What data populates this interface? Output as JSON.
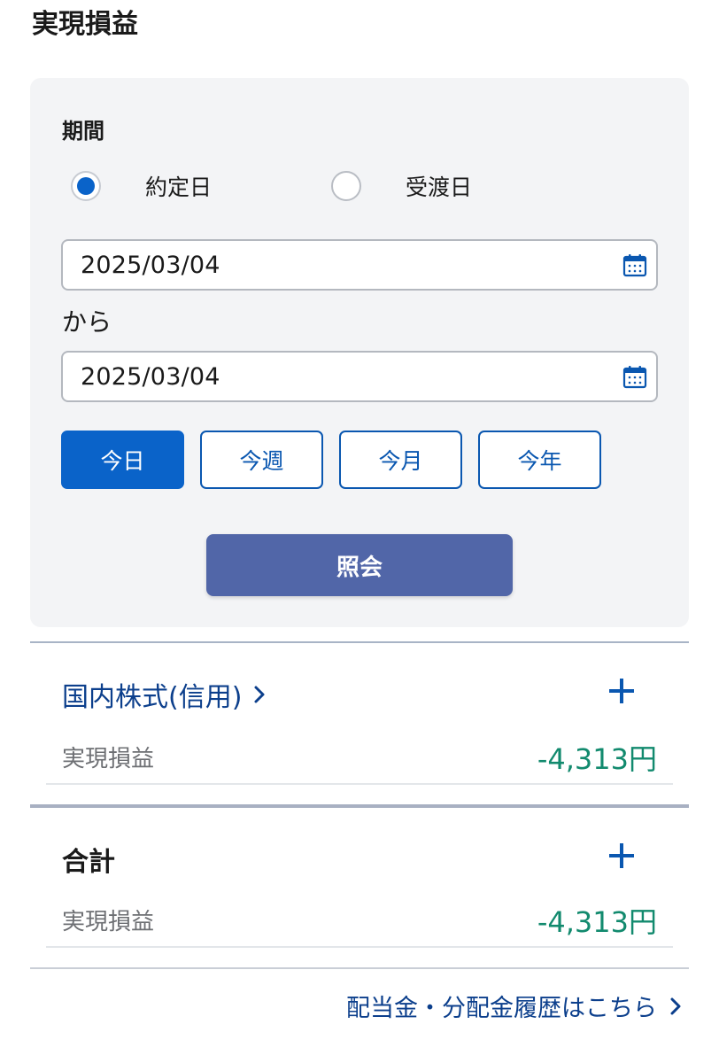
{
  "page": {
    "title": "実現損益"
  },
  "filter": {
    "period_label": "期間",
    "radio_options": [
      {
        "label": "約定日",
        "checked": true
      },
      {
        "label": "受渡日",
        "checked": false
      }
    ],
    "start_date": "2025/03/04",
    "from_label": "から",
    "end_date": "2025/03/04",
    "quick_ranges": [
      {
        "label": "今日",
        "active": true
      },
      {
        "label": "今週",
        "active": false
      },
      {
        "label": "今月",
        "active": false
      },
      {
        "label": "今年",
        "active": false
      }
    ],
    "search_label": "照会"
  },
  "sections": [
    {
      "title": "国内株式(信用)",
      "row_label": "実現損益",
      "row_value": "-4,313円"
    },
    {
      "title": "合計",
      "row_label": "実現損益",
      "row_value": "-4,313円"
    }
  ],
  "footer": {
    "link_label": "配当金・分配金履歴はこちら"
  },
  "colors": {
    "primary": "#0a63c9",
    "link": "#0c3f8c",
    "search_button": "#5166a8",
    "value_teal": "#128a6e",
    "panel_bg": "#f3f4f6"
  },
  "icons": [
    "calendar-icon",
    "plus-icon",
    "chevron-right-icon"
  ]
}
